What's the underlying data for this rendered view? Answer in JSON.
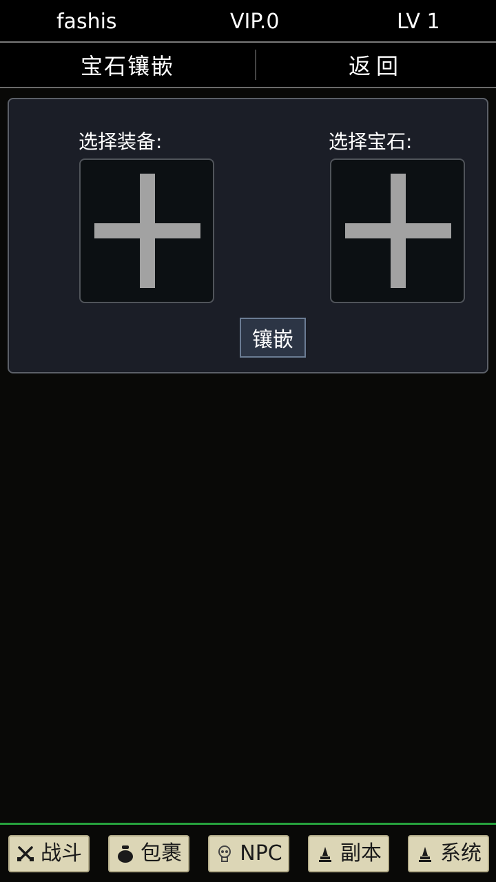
{
  "status": {
    "username": "fashis",
    "vip": "VIP.0",
    "level": "LV 1"
  },
  "header": {
    "title": "宝石镶嵌",
    "back_label": "返回"
  },
  "panel": {
    "equipment_label": "选择装备:",
    "gem_label": "选择宝石:",
    "inlay_button": "镶嵌"
  },
  "nav": {
    "items": [
      {
        "label": "战斗",
        "icon": "crossed-swords-icon"
      },
      {
        "label": "包裹",
        "icon": "bag-icon"
      },
      {
        "label": "NPC",
        "icon": "skull-icon"
      },
      {
        "label": "副本",
        "icon": "pawn-icon"
      },
      {
        "label": "系统",
        "icon": "pawn-icon"
      }
    ]
  },
  "colors": {
    "accent_green": "#27a33d",
    "nav_button_bg": "#dcd6b6",
    "panel_bg": "#1b1e27"
  }
}
